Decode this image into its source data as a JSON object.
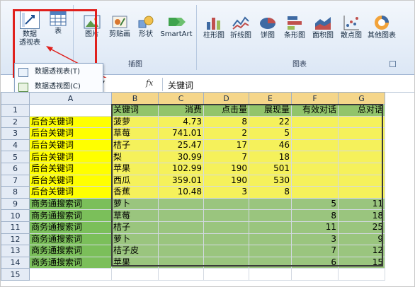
{
  "ribbon": {
    "pivot_btn": "数据\n透视表",
    "pivot_btn_line1": "数据",
    "pivot_btn_line2": "透视表",
    "table_btn": "表",
    "picture_btn": "图片",
    "clipart_btn": "剪贴画",
    "shapes_btn": "形状",
    "smartart_btn": "SmartArt",
    "insert_group": "插图",
    "chart_buttons": [
      "柱形图",
      "折线图",
      "饼图",
      "条形图",
      "面积图",
      "散点图",
      "其他图表"
    ],
    "charts_group": "图表",
    "dropdown_items": [
      "数据透视表(T)",
      "数据透视图(C)"
    ]
  },
  "formula_bar": {
    "fx": "fx",
    "value": "关键词"
  },
  "columns": [
    "A",
    "B",
    "C",
    "D",
    "E",
    "F",
    "G"
  ],
  "rows": [
    {
      "n": "1",
      "cells": [
        "",
        "关键词",
        "消费",
        "点击量",
        "展现量",
        "有效对话",
        "总对话"
      ]
    },
    {
      "n": "2",
      "cells": [
        "后台关键词",
        "菠萝",
        "4.73",
        "8",
        "22",
        "",
        ""
      ]
    },
    {
      "n": "3",
      "cells": [
        "后台关键词",
        "草莓",
        "741.01",
        "2",
        "5",
        "",
        ""
      ]
    },
    {
      "n": "4",
      "cells": [
        "后台关键词",
        "桔子",
        "25.47",
        "17",
        "46",
        "",
        ""
      ]
    },
    {
      "n": "5",
      "cells": [
        "后台关键词",
        "梨",
        "30.99",
        "7",
        "18",
        "",
        ""
      ]
    },
    {
      "n": "6",
      "cells": [
        "后台关键词",
        "苹果",
        "102.99",
        "190",
        "501",
        "",
        ""
      ]
    },
    {
      "n": "7",
      "cells": [
        "后台关键词",
        "西瓜",
        "359.01",
        "190",
        "530",
        "",
        ""
      ]
    },
    {
      "n": "8",
      "cells": [
        "后台关键词",
        "香蕉",
        "10.48",
        "3",
        "8",
        "",
        ""
      ]
    },
    {
      "n": "9",
      "cells": [
        "商务通搜索词",
        "萝卜",
        "",
        "",
        "",
        "5",
        "11"
      ]
    },
    {
      "n": "10",
      "cells": [
        "商务通搜索词",
        "草莓",
        "",
        "",
        "",
        "8",
        "18"
      ]
    },
    {
      "n": "11",
      "cells": [
        "商务通搜索词",
        "桔子",
        "",
        "",
        "",
        "11",
        "25"
      ]
    },
    {
      "n": "12",
      "cells": [
        "商务通搜索词",
        "萝卜",
        "",
        "",
        "",
        "3",
        "9"
      ]
    },
    {
      "n": "13",
      "cells": [
        "商务通搜索词",
        "桔子皮",
        "",
        "",
        "",
        "7",
        "12"
      ]
    },
    {
      "n": "14",
      "cells": [
        "商务通搜索词",
        "苹果",
        "",
        "",
        "",
        "6",
        "15"
      ]
    },
    {
      "n": "15",
      "cells": [
        "",
        "",
        "",
        "",
        "",
        "",
        ""
      ]
    }
  ]
}
